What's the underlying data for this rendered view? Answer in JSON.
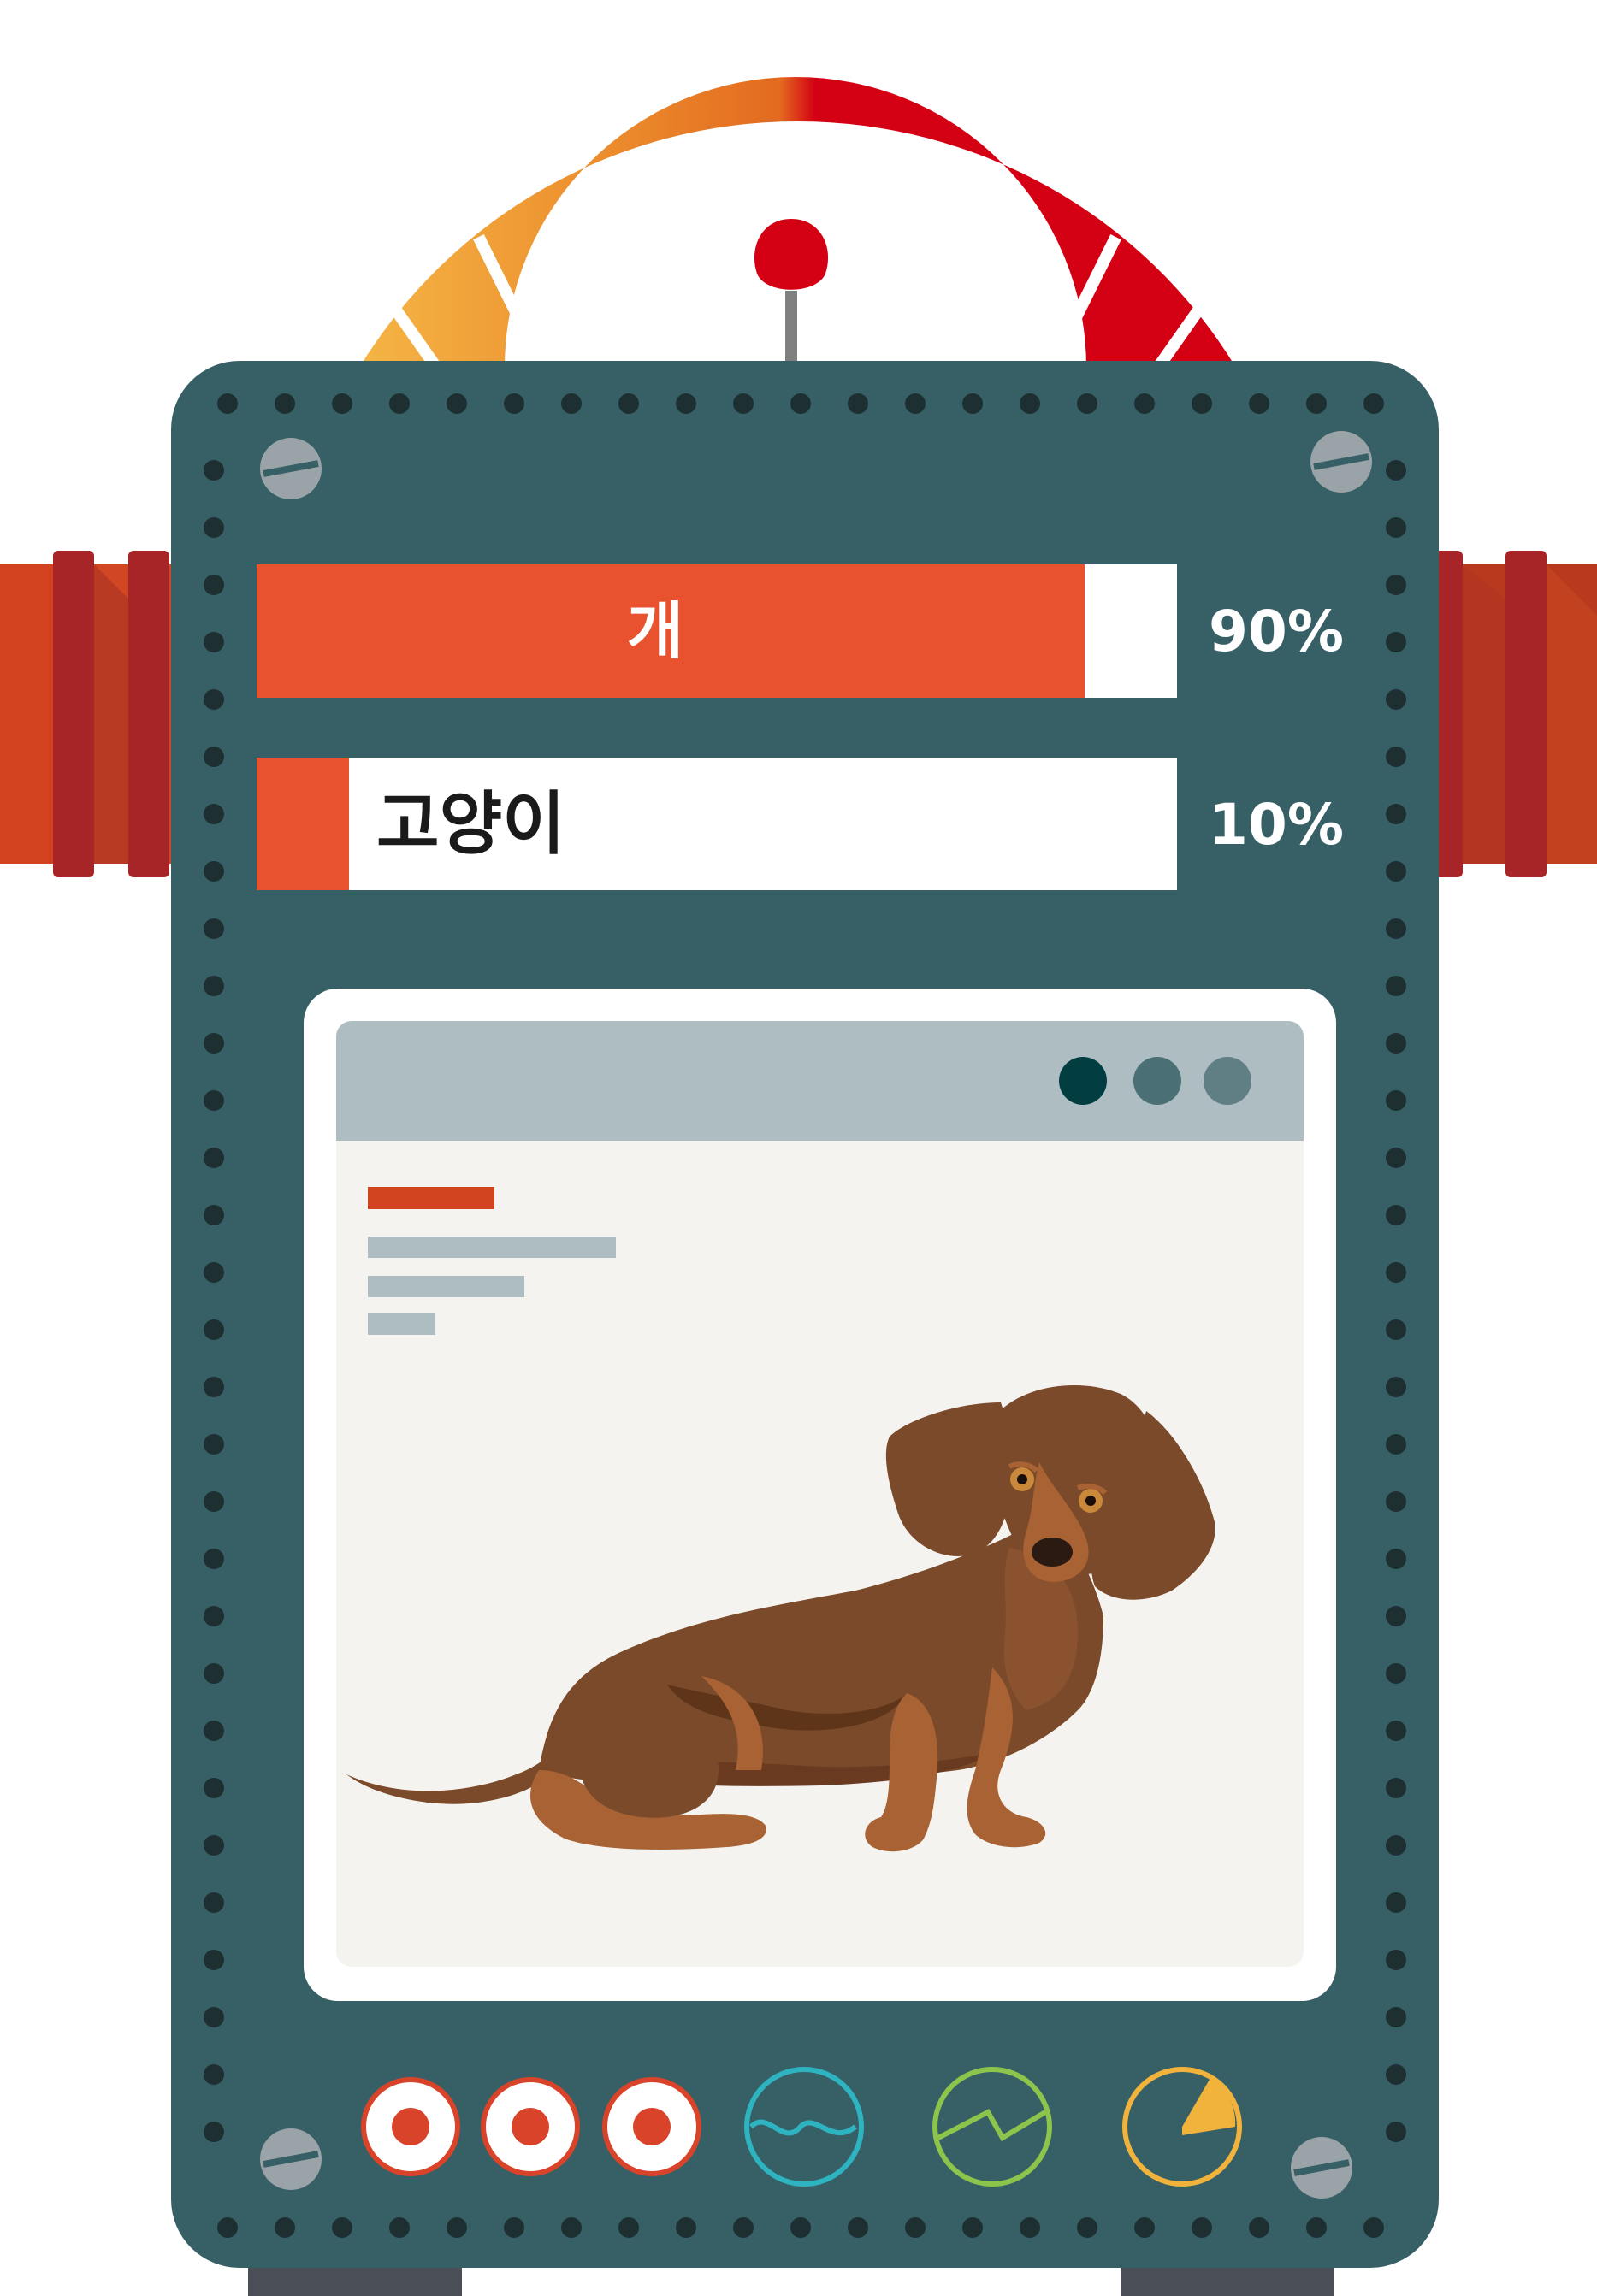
{
  "classification": {
    "items": [
      {
        "label": "개",
        "percent_text": "90%",
        "value": 0.9
      },
      {
        "label": "고양이",
        "percent_text": "10%",
        "value": 0.1
      }
    ]
  },
  "gauge": {
    "level": 0.55
  },
  "browser_window": {
    "dots": [
      "#023d41",
      "#4a6f74",
      "#5f7f85"
    ]
  },
  "bottom_controls": {
    "buttons": [
      "record",
      "record",
      "record"
    ],
    "indicators": [
      "wave-icon",
      "line-chart-icon",
      "pie-chart-icon"
    ]
  },
  "colors": {
    "panel": "#376066",
    "bar_fill": "#e8522f",
    "gauge_red": "#d40013",
    "gauge_orange": "#e47424",
    "gauge_yellow": "#f3b142",
    "pipe_red": "#a72526",
    "cyan": "#2eb3c0",
    "green": "#8cc44c",
    "yellow": "#f1b33c"
  }
}
